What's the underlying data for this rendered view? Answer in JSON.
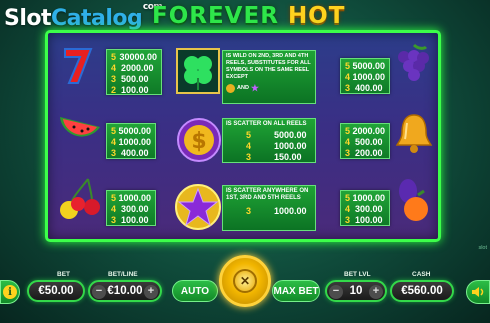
{
  "watermark": {
    "slot": "Slot",
    "catalog": "Catalog",
    "com": "com"
  },
  "title": {
    "forever": "FOREVER",
    "hot": "HOT"
  },
  "paytable": {
    "seven": [
      [
        "5",
        "30000.00"
      ],
      [
        "4",
        "2000.00"
      ],
      [
        "3",
        "500.00"
      ],
      [
        "2",
        "100.00"
      ]
    ],
    "grapes": [
      [
        "5",
        "5000.00"
      ],
      [
        "4",
        "1000.00"
      ],
      [
        "3",
        "400.00"
      ]
    ],
    "watermelon": [
      [
        "5",
        "5000.00"
      ],
      [
        "4",
        "1000.00"
      ],
      [
        "3",
        "400.00"
      ]
    ],
    "bell": [
      [
        "5",
        "2000.00"
      ],
      [
        "4",
        "500.00"
      ],
      [
        "3",
        "200.00"
      ]
    ],
    "cherry": [
      [
        "5",
        "1000.00"
      ],
      [
        "4",
        "300.00"
      ],
      [
        "3",
        "100.00"
      ]
    ],
    "orange": [
      [
        "5",
        "1000.00"
      ],
      [
        "4",
        "300.00"
      ],
      [
        "3",
        "100.00"
      ]
    ],
    "dollar": [
      [
        "5",
        "5000.00"
      ],
      [
        "4",
        "1000.00"
      ],
      [
        "3",
        "150.00"
      ]
    ],
    "star": [
      [
        "3",
        "1000.00"
      ]
    ]
  },
  "wild_text": "IS WILD ON 2ND, 3RD AND 4TH REELS, SUBSTITUTES FOR ALL SYMBOLS ON THE SAME REEL EXCEPT",
  "wild_and": "AND",
  "dollar_text": "IS SCATTER ON ALL REELS",
  "star_text": "IS SCATTER ANYWHERE ON 1ST, 3RD AND 5TH REELS",
  "controls": {
    "bet_label": "BET",
    "bet_value": "€50.00",
    "betline_label": "BET/LINE",
    "betline_value": "€10.00",
    "minus": "−",
    "plus": "+",
    "auto_label": "AUTO",
    "maxbet_label": "MAX BET",
    "betlvl_label": "BET LVL",
    "betlvl_value": "10",
    "cash_label": "CASH",
    "cash_value": "€560.00",
    "spin_symbol": "✕",
    "info_symbol": "i"
  },
  "brand": "slot"
}
